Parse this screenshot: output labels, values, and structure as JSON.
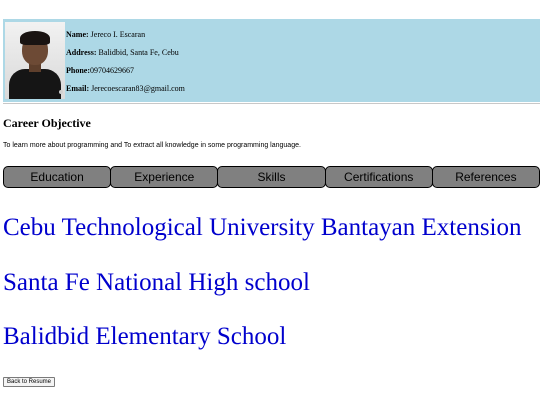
{
  "profile": {
    "photo_alt": "profile photo",
    "name_label": "Name:",
    "name": "Jereco I. Escaran",
    "address_label": "Address:",
    "address": "Balidbid, Santa Fe, Cebu",
    "phone_label": "Phone:",
    "phone": "09704629667",
    "email_label": "Email:",
    "email": "Jerecoescaran83@gmail.com"
  },
  "objective": {
    "title": "Career Objective",
    "text": "To learn more about programming and To extract all knowledge in some programming language."
  },
  "tabs": [
    {
      "label": "Education"
    },
    {
      "label": "Experience"
    },
    {
      "label": "Skills"
    },
    {
      "label": "Certifications"
    },
    {
      "label": "References"
    }
  ],
  "education": {
    "schools": [
      "Cebu Technological University Bantayan Extension",
      "Santa Fe National High school",
      "Balidbid Elementary School"
    ]
  },
  "back_button": "Back to Resume",
  "colors": {
    "header_background": "#add8e6",
    "tab_background": "#808080",
    "school_text": "#0000cd"
  }
}
